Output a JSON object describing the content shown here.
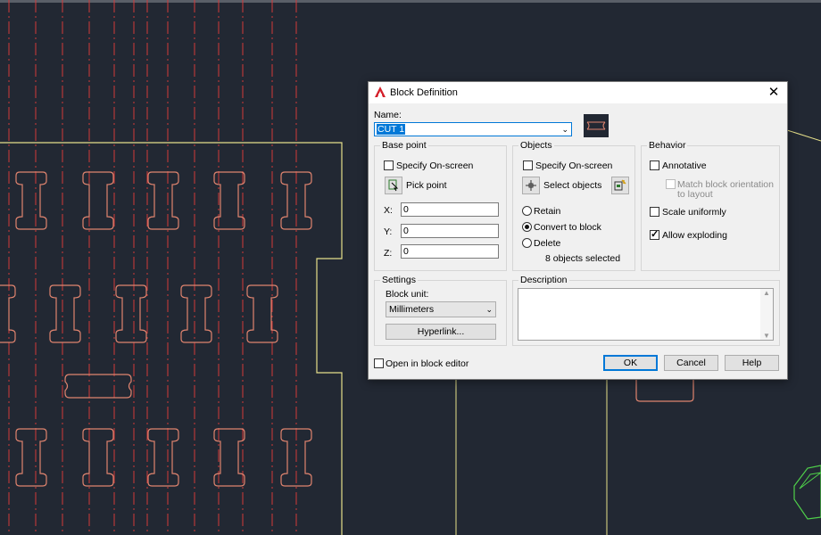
{
  "dialog": {
    "title": "Block Definition",
    "close_symbol": "✕",
    "icon": "autocad-logo-icon"
  },
  "name": {
    "label": "Name:",
    "value": "CUT 1"
  },
  "base_point": {
    "group_title": "Base point",
    "specify_on_screen": "Specify On-screen",
    "specify_on_screen_checked": false,
    "pick_point": "Pick point",
    "x_label": "X:",
    "x_value": "0",
    "y_label": "Y:",
    "y_value": "0",
    "z_label": "Z:",
    "z_value": "0"
  },
  "objects": {
    "group_title": "Objects",
    "specify_on_screen": "Specify On-screen",
    "specify_on_screen_checked": false,
    "select_objects": "Select objects",
    "retain": "Retain",
    "convert_to_block": "Convert to block",
    "delete": "Delete",
    "selected_option": "Convert to block",
    "status": "8 objects selected"
  },
  "behavior": {
    "group_title": "Behavior",
    "annotative": "Annotative",
    "annotative_checked": false,
    "match_orientation_line1": "Match block orientation",
    "match_orientation_line2": "to layout",
    "scale_uniformly": "Scale uniformly",
    "scale_uniformly_checked": false,
    "allow_exploding": "Allow exploding",
    "allow_exploding_checked": true
  },
  "settings": {
    "group_title": "Settings",
    "block_unit_label": "Block unit:",
    "block_unit_value": "Millimeters",
    "hyperlink": "Hyperlink..."
  },
  "description": {
    "group_title": "Description",
    "value": ""
  },
  "footer": {
    "open_in_block_editor": "Open in block editor",
    "open_in_block_editor_checked": false,
    "ok": "OK",
    "cancel": "Cancel",
    "help": "Help"
  },
  "colors": {
    "background": "#222833",
    "centerline": "#d23a3a",
    "cut_shape": "#e0846f",
    "boundary": "#e6e08a",
    "green_shape": "#4fd04a",
    "default_button": "#0078d7"
  }
}
